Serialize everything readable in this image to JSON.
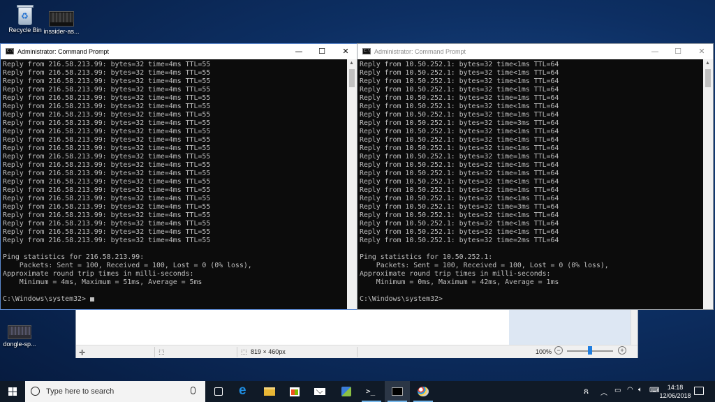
{
  "desktop": {
    "icons": [
      {
        "label": "Recycle Bin"
      },
      {
        "label": "inssider-as..."
      },
      {
        "label": "dongle-sp..."
      }
    ]
  },
  "paint_window": {
    "canvas_size": "819 × 460px",
    "zoom": "100%"
  },
  "left_cmd": {
    "title": "Administrator: Command Prompt",
    "reply_line": "Reply from 216.58.213.99: bytes=32 time=4ms TTL=55",
    "reply_count": 22,
    "stats_header": "Ping statistics for 216.58.213.99:",
    "packets_line": "    Packets: Sent = 100, Received = 100, Lost = 0 (0% loss),",
    "approx_line": "Approximate round trip times in milli-seconds:",
    "minmax_line": "    Minimum = 4ms, Maximum = 51ms, Average = 5ms",
    "prompt": "C:\\Windows\\system32>"
  },
  "right_cmd": {
    "title": "Administrator: Command Prompt",
    "reply_prefix": "Reply from 10.50.252.1: bytes=32 ",
    "reply_suffix": " TTL=64",
    "reply_times": [
      "time<1ms",
      "time<1ms",
      "time<1ms",
      "time<1ms",
      "time=1ms",
      "time<1ms",
      "time=1ms",
      "time=3ms",
      "time<1ms",
      "time<1ms",
      "time<1ms",
      "time=1ms",
      "time<1ms",
      "time=1ms",
      "time<1ms",
      "time=1ms",
      "time<1ms",
      "time=3ms",
      "time<1ms",
      "time<1ms",
      "time<1ms",
      "time=2ms"
    ],
    "stats_header": "Ping statistics for 10.50.252.1:",
    "packets_line": "    Packets: Sent = 100, Received = 100, Lost = 0 (0% loss),",
    "approx_line": "Approximate round trip times in milli-seconds:",
    "minmax_line": "    Minimum = 0ms, Maximum = 42ms, Average = 1ms",
    "prompt": "C:\\Windows\\system32>"
  },
  "window_controls": {
    "minimize": "—",
    "maximize": "☐",
    "close": "✕"
  },
  "taskbar": {
    "search_placeholder": "Type here to search",
    "ps_glyph": ">_",
    "time": "14:18",
    "date": "12/06/2018",
    "edge_glyph": "e"
  },
  "colors": {
    "console_bg": "#0c0c0c",
    "console_text": "#c0c0c0",
    "taskbar_bg": "#101a27",
    "accent": "#76b9ed"
  }
}
